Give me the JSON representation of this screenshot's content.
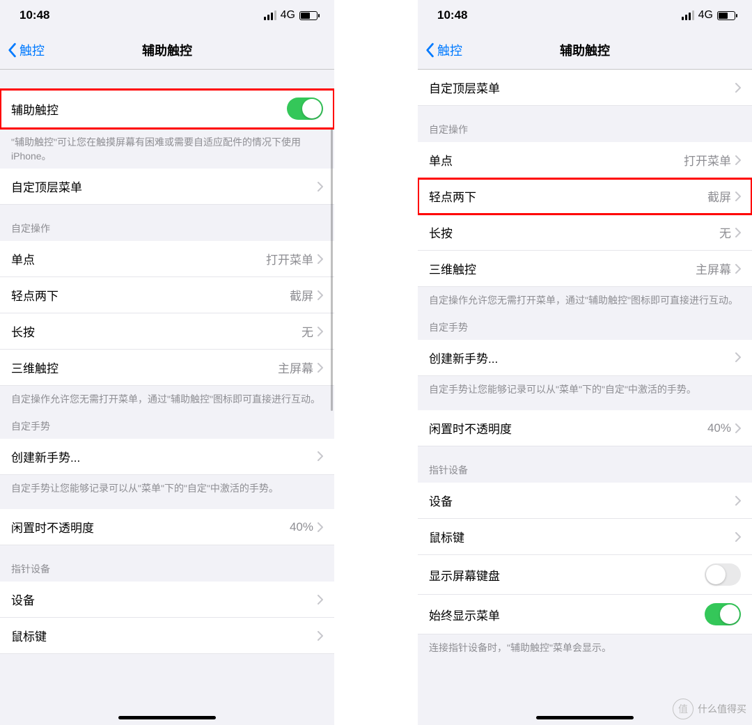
{
  "statusbar": {
    "time": "10:48",
    "network": "4G"
  },
  "navbar": {
    "back": "触控",
    "title": "辅助触控"
  },
  "left": {
    "main_toggle": {
      "label": "辅助触控",
      "on": true
    },
    "main_footer": "\"辅助触控\"可让您在触摸屏幕有困难或需要自适应配件的情况下使用 iPhone。",
    "custom_top": {
      "label": "自定顶层菜单"
    },
    "actions_header": "自定操作",
    "actions": [
      {
        "label": "单点",
        "value": "打开菜单"
      },
      {
        "label": "轻点两下",
        "value": "截屏"
      },
      {
        "label": "长按",
        "value": "无"
      },
      {
        "label": "三维触控",
        "value": "主屏幕"
      }
    ],
    "actions_footer": "自定操作允许您无需打开菜单，通过\"辅助触控\"图标即可直接进行互动。",
    "gestures_header": "自定手势",
    "create_gesture": "创建新手势...",
    "gestures_footer": "自定手势让您能够记录可以从\"菜单\"下的\"自定\"中激活的手势。",
    "opacity": {
      "label": "闲置时不透明度",
      "value": "40%"
    },
    "pointer_header": "指针设备",
    "device": "设备",
    "mouse_keys": "鼠标键"
  },
  "right": {
    "custom_top": {
      "label": "自定顶层菜单"
    },
    "actions_header": "自定操作",
    "actions": [
      {
        "label": "单点",
        "value": "打开菜单"
      },
      {
        "label": "轻点两下",
        "value": "截屏"
      },
      {
        "label": "长按",
        "value": "无"
      },
      {
        "label": "三维触控",
        "value": "主屏幕"
      }
    ],
    "actions_footer": "自定操作允许您无需打开菜单，通过\"辅助触控\"图标即可直接进行互动。",
    "gestures_header": "自定手势",
    "create_gesture": "创建新手势...",
    "gestures_footer": "自定手势让您能够记录可以从\"菜单\"下的\"自定\"中激活的手势。",
    "opacity": {
      "label": "闲置时不透明度",
      "value": "40%"
    },
    "pointer_header": "指针设备",
    "device": "设备",
    "mouse_keys": "鼠标键",
    "show_keyboard": {
      "label": "显示屏幕键盘",
      "on": false
    },
    "always_show_menu": {
      "label": "始终显示菜单",
      "on": true
    },
    "pointer_footer": "连接指针设备时，\"辅助触控\"菜单会显示。"
  },
  "watermark": "什么值得买"
}
